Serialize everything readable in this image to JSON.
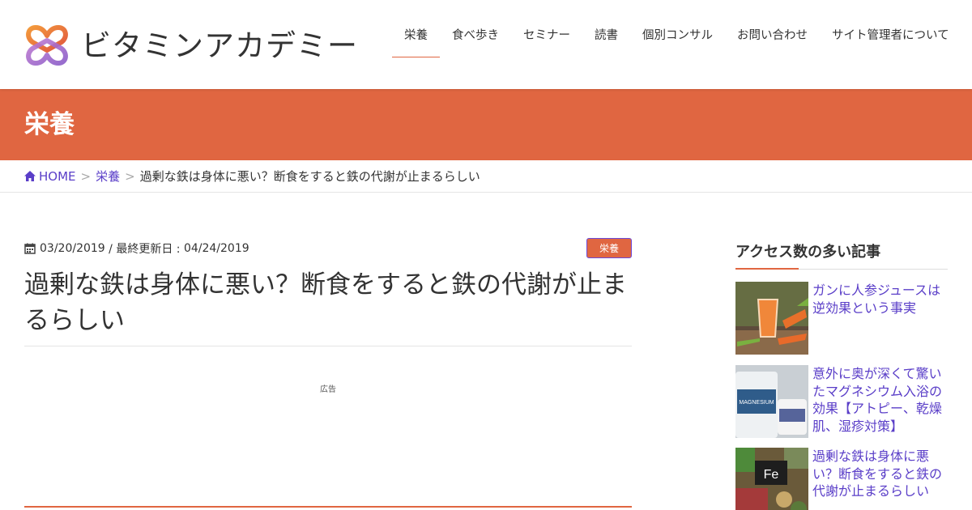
{
  "site": {
    "name": "ビタミンアカデミー"
  },
  "nav": {
    "items": [
      {
        "label": "栄養"
      },
      {
        "label": "食べ歩き"
      },
      {
        "label": "セミナー"
      },
      {
        "label": "読書"
      },
      {
        "label": "個別コンサル"
      },
      {
        "label": "お問い合わせ"
      },
      {
        "label": "サイト管理者について"
      }
    ]
  },
  "page_header": {
    "title": "栄養"
  },
  "breadcrumb": {
    "home": "HOME",
    "category": "栄養",
    "sep": ">",
    "current": "過剰な鉄は身体に悪い？断食をすると鉄の代謝が止まるらしい"
  },
  "post": {
    "date": "03/20/2019",
    "updated_prefix": "/ 最終更新日 :",
    "updated": "04/24/2019",
    "category_badge": "栄養",
    "title": "過剰な鉄は身体に悪い？断食をすると鉄の代謝が止まるらしい",
    "ad_label": "広告"
  },
  "sidebar": {
    "title": "アクセス数の多い記事",
    "articles": [
      {
        "title": "ガンに人参ジュースは逆効果という事実"
      },
      {
        "title": "意外に奥が深くて驚いたマグネシウム入浴の効果【アトピー、乾燥肌、湿疹対策】"
      },
      {
        "title": "過剰な鉄は身体に悪い？断食をすると鉄の代謝が止まるらしい"
      }
    ],
    "thumb_text_fe": "Fe",
    "thumb_text_magnesium": "MAGNESIUM"
  },
  "colors": {
    "accent": "#e06641",
    "link": "#5a3ec8"
  }
}
